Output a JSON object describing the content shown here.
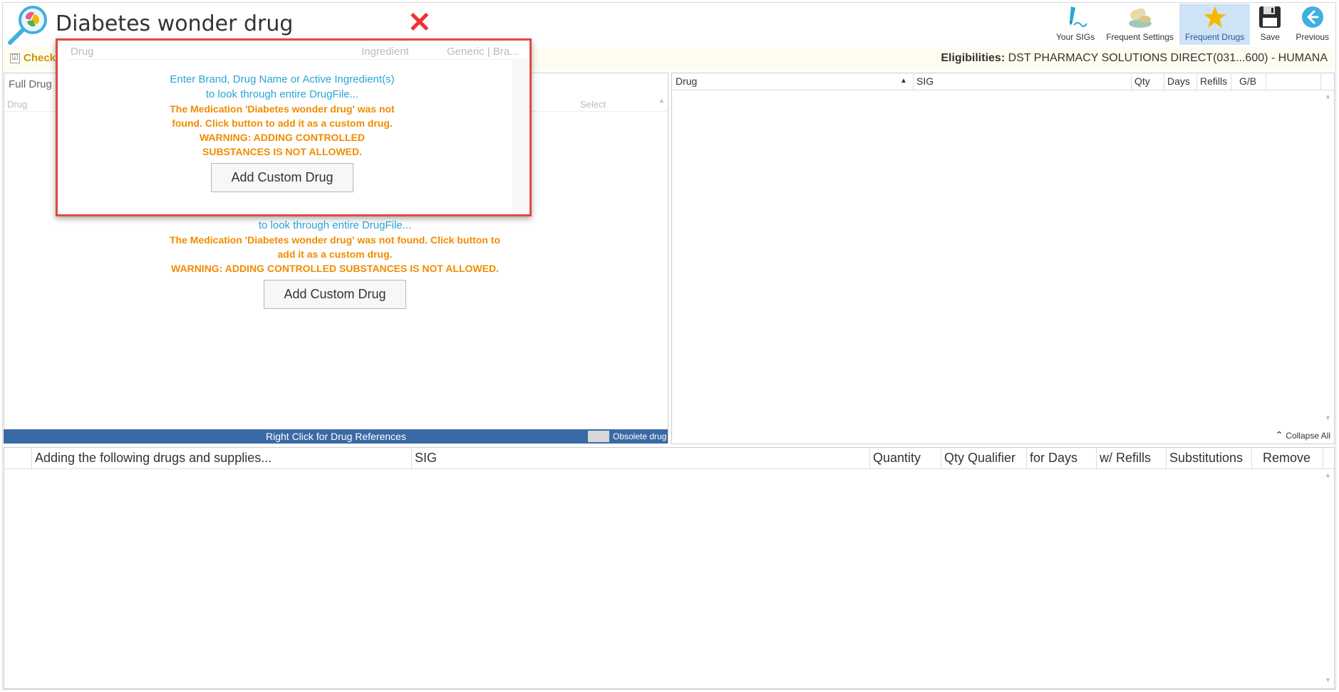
{
  "window": {
    "title": "Diabetes wonder drug",
    "close_symbol": "✕"
  },
  "toolbar": {
    "items": [
      {
        "label": "Your SIGs",
        "icon": "pen-sig-icon"
      },
      {
        "label": "Frequent Settings",
        "icon": "pills-settings-icon"
      },
      {
        "label": "Frequent Drugs",
        "icon": "star-icon",
        "active": true
      },
      {
        "label": "Save",
        "icon": "floppy-save-icon"
      },
      {
        "label": "Previous",
        "icon": "back-arrow-icon"
      }
    ]
  },
  "check": {
    "mark": "☑",
    "label": "Check"
  },
  "eligibilities": {
    "label": "Eligibilities:",
    "value": "DST PHARMACY SOLUTIONS DIRECT(031...600) - HUMANA"
  },
  "left_panel": {
    "tab": "Full Drug",
    "columns": {
      "drug": "Drug",
      "select": "Select"
    },
    "message_line2": "to look through entire DrugFile...",
    "warning": "The Medication 'Diabetes wonder drug' was not found. Click button to add it as a custom drug.",
    "warning2": "WARNING: ADDING CONTROLLED SUBSTANCES IS NOT ALLOWED.",
    "button": "Add Custom Drug",
    "footer": "Right Click for Drug References",
    "obsolete_label": "Obsolete drug"
  },
  "right_panel": {
    "columns": [
      "Drug",
      "SIG",
      "Qty",
      "Days",
      "Refills",
      "G/B"
    ],
    "collapse_all": "Collapse All"
  },
  "bottom_panel": {
    "columns": [
      "Adding the following drugs and supplies...",
      "SIG",
      "Quantity",
      "Qty Qualifier",
      "for Days",
      "w/ Refills",
      "Substitutions",
      "Remove"
    ]
  },
  "popup": {
    "columns": {
      "drug": "Drug",
      "ingredient": "Ingredient",
      "generic": "Generic | Bra..."
    },
    "message_line1": "Enter Brand, Drug Name or Active Ingredient(s)",
    "message_line2": "to look through entire DrugFile...",
    "warning": "The Medication 'Diabetes wonder drug' was not found. Click button to add it as a custom drug.",
    "warning2": "WARNING: ADDING CONTROLLED SUBSTANCES IS NOT ALLOWED.",
    "button": "Add Custom Drug"
  },
  "colors": {
    "accent_blue": "#3a6aa5",
    "hint_blue": "#29a5d9",
    "warning_orange": "#f08c00",
    "popup_border": "#e04848",
    "close_red": "#e33333"
  }
}
